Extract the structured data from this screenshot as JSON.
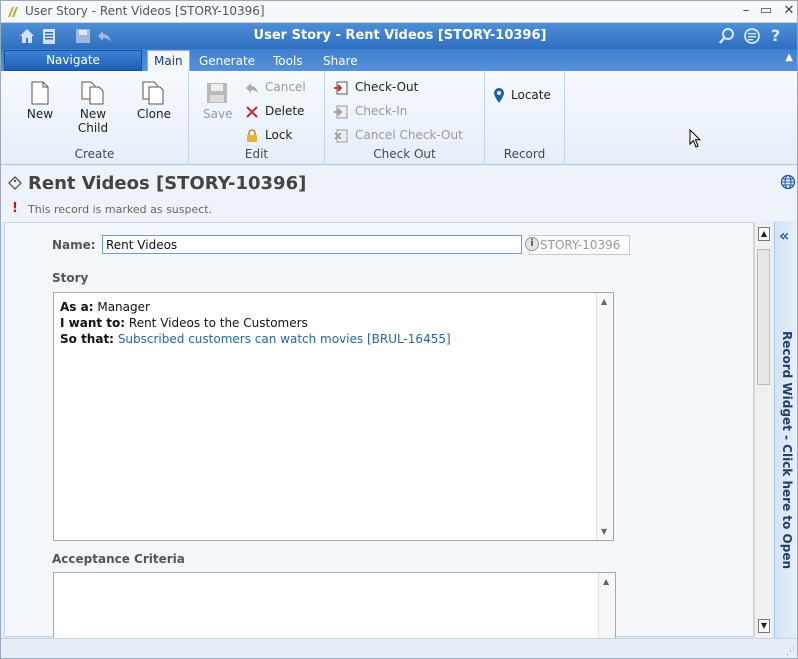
{
  "window": {
    "os_title": "User Story - Rent Videos [STORY-10396]",
    "app_title": "User Story - Rent Videos [STORY-10396]",
    "minimize": "–",
    "maximize": "▭",
    "close": "✕"
  },
  "tabs": {
    "navigate": "Navigate",
    "items": [
      "Main",
      "Generate",
      "Tools",
      "Share"
    ],
    "active": "Main"
  },
  "ribbon": {
    "create": {
      "title": "Create",
      "new": "New",
      "new_child": "New Child",
      "clone": "Clone"
    },
    "edit": {
      "title": "Edit",
      "save": "Save",
      "cancel": "Cancel",
      "delete": "Delete",
      "lock": "Lock"
    },
    "checkout": {
      "title": "Check Out",
      "check_out": "Check-Out",
      "check_in": "Check-In",
      "cancel_check_out": "Cancel Check-Out"
    },
    "record": {
      "title": "Record",
      "locate": "Locate"
    }
  },
  "record": {
    "title": "Rent Videos [STORY-10396]",
    "suspect_mark": "!",
    "suspect_message": "This record is marked as suspect."
  },
  "form": {
    "name_label": "Name:",
    "name_value": "Rent Videos",
    "id_info": "i",
    "id_value": "STORY-10396",
    "story_label": "Story",
    "story": {
      "as_a_label": "As a:",
      "as_a_value": "Manager",
      "i_want_label": "I want to:",
      "i_want_value": "Rent Videos to the Customers",
      "so_that_label": "So that:",
      "so_that_value": "Subscribed customers can watch movies [BRUL-16455]"
    },
    "acceptance_label": "Acceptance Criteria"
  },
  "widget": {
    "label": "Record Widget - Click here to Open",
    "collapse": "«"
  },
  "colors": {
    "header_blue": "#2f6fc0",
    "link": "#2266aa",
    "suspect_red": "#c0141b"
  }
}
